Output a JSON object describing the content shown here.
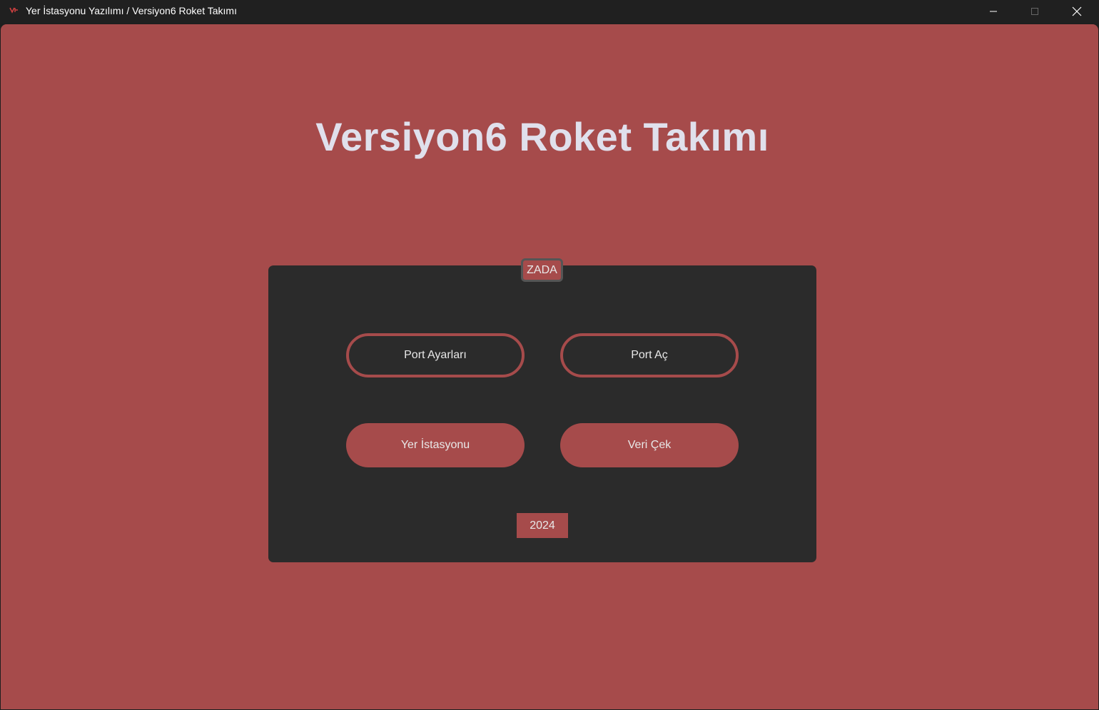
{
  "window": {
    "title": "Yer İstasyonu Yazılımı / Versiyon6 Roket Takımı",
    "icon": "app-logo-icon",
    "controls": [
      "minimize-icon",
      "maximize-icon",
      "close-icon"
    ]
  },
  "main": {
    "heading": "Versiyon6 Roket Takımı",
    "panel": {
      "label": "ZADA",
      "buttons": {
        "port_settings": "Port Ayarları",
        "port_open": "Port Aç",
        "ground_station": "Yer İstasyonu",
        "fetch_data": "Veri Çek"
      },
      "year": "2024"
    }
  },
  "colors": {
    "background": "#a64b4b",
    "panel": "#2b2b2b",
    "text": "#e8e8e8",
    "heading": "#e0e0ec"
  }
}
